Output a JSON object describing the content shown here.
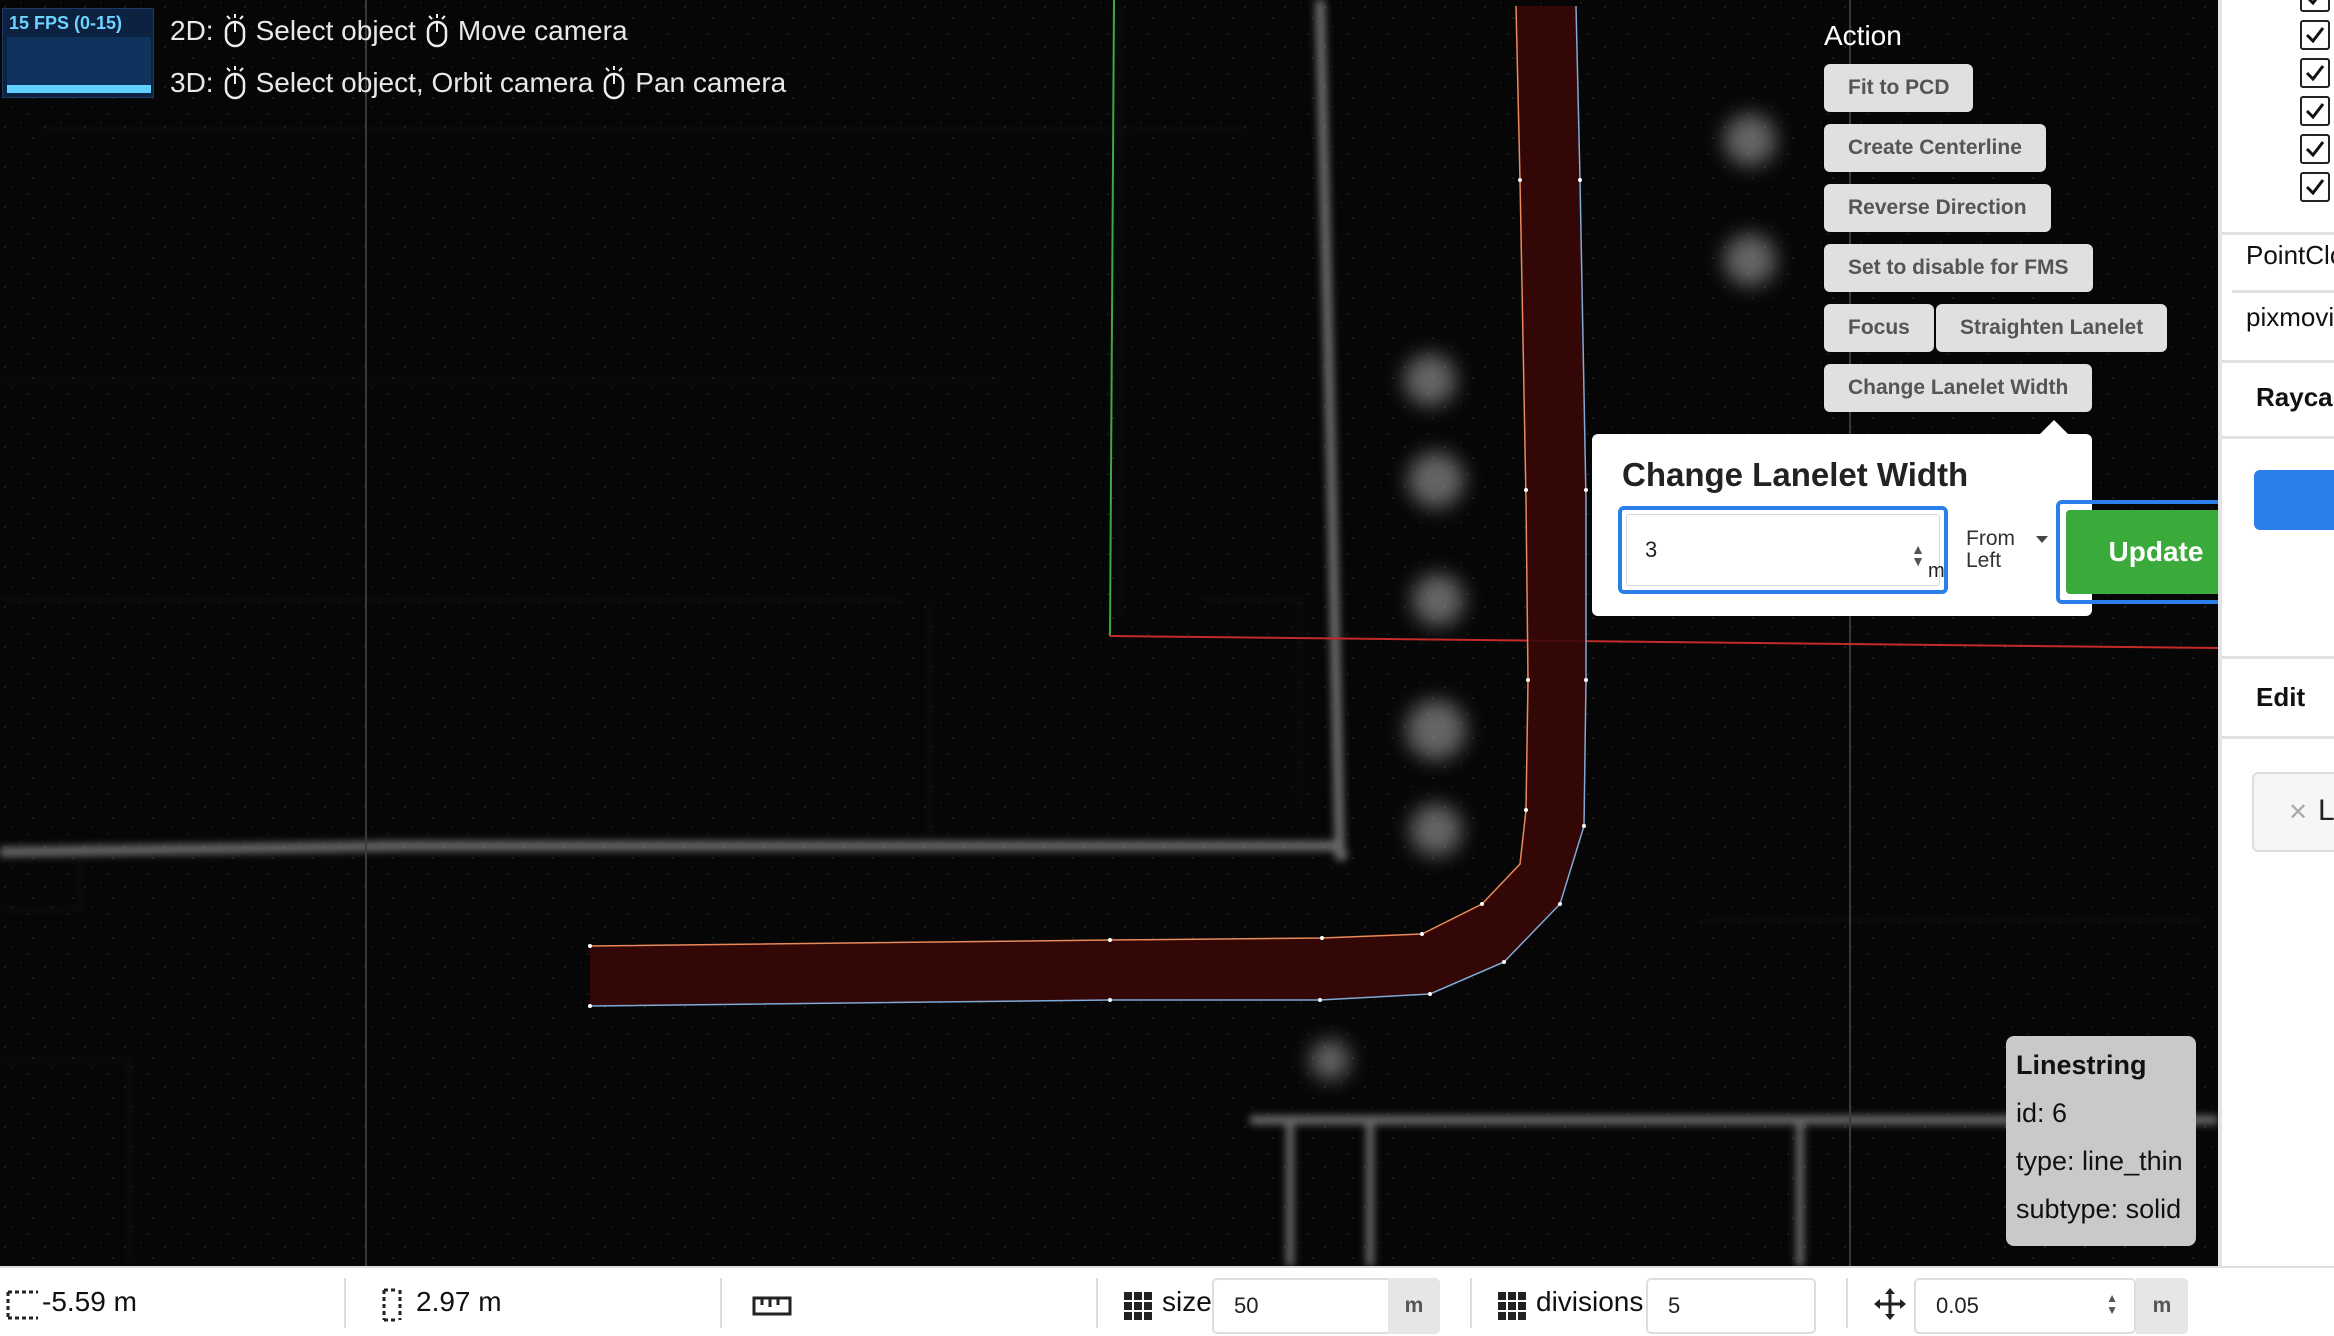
{
  "fps": {
    "label": "15 FPS (0-15)"
  },
  "hints": {
    "row2d": {
      "prefix": "2D:",
      "select": "Select object",
      "move": "Move camera"
    },
    "row3d": {
      "prefix": "3D:",
      "select": "Select object, Orbit camera",
      "pan": "Pan camera"
    }
  },
  "action": {
    "title": "Action",
    "fit_to_pcd": "Fit to PCD",
    "create_centerline": "Create Centerline",
    "reverse_direction": "Reverse Direction",
    "set_disable_fms": "Set to disable for FMS",
    "focus": "Focus",
    "straighten_lanelet": "Straighten Lanelet",
    "change_lanelet_width": "Change Lanelet Width"
  },
  "popup": {
    "title": "Change Lanelet Width",
    "width_value": "3",
    "unit": "m",
    "direction": "From Left",
    "update_label": "Update"
  },
  "sidepanel": {
    "pointcloud_label": "PointClo",
    "pointcloud_file": "pixmovi",
    "raycast_label": "Raycas",
    "blue_tab_label": "",
    "edit_label": "Edit",
    "ll_button": "Ll"
  },
  "info": {
    "title": "Linestring",
    "id": "id: 6",
    "type": "type: line_thin",
    "subtype": "subtype: solid"
  },
  "bottom": {
    "x_value": "-5.59 m",
    "y_value": "2.97 m",
    "size_label": "size",
    "size_value": "50",
    "size_unit": "m",
    "divisions_label": "divisions",
    "divisions_value": "5",
    "snap_value": "0.05",
    "snap_unit": "m"
  },
  "colors": {
    "lanelet_fill": "#3a0808",
    "update_green": "#3aaa3a",
    "focus_blue": "#2a7fe8"
  }
}
